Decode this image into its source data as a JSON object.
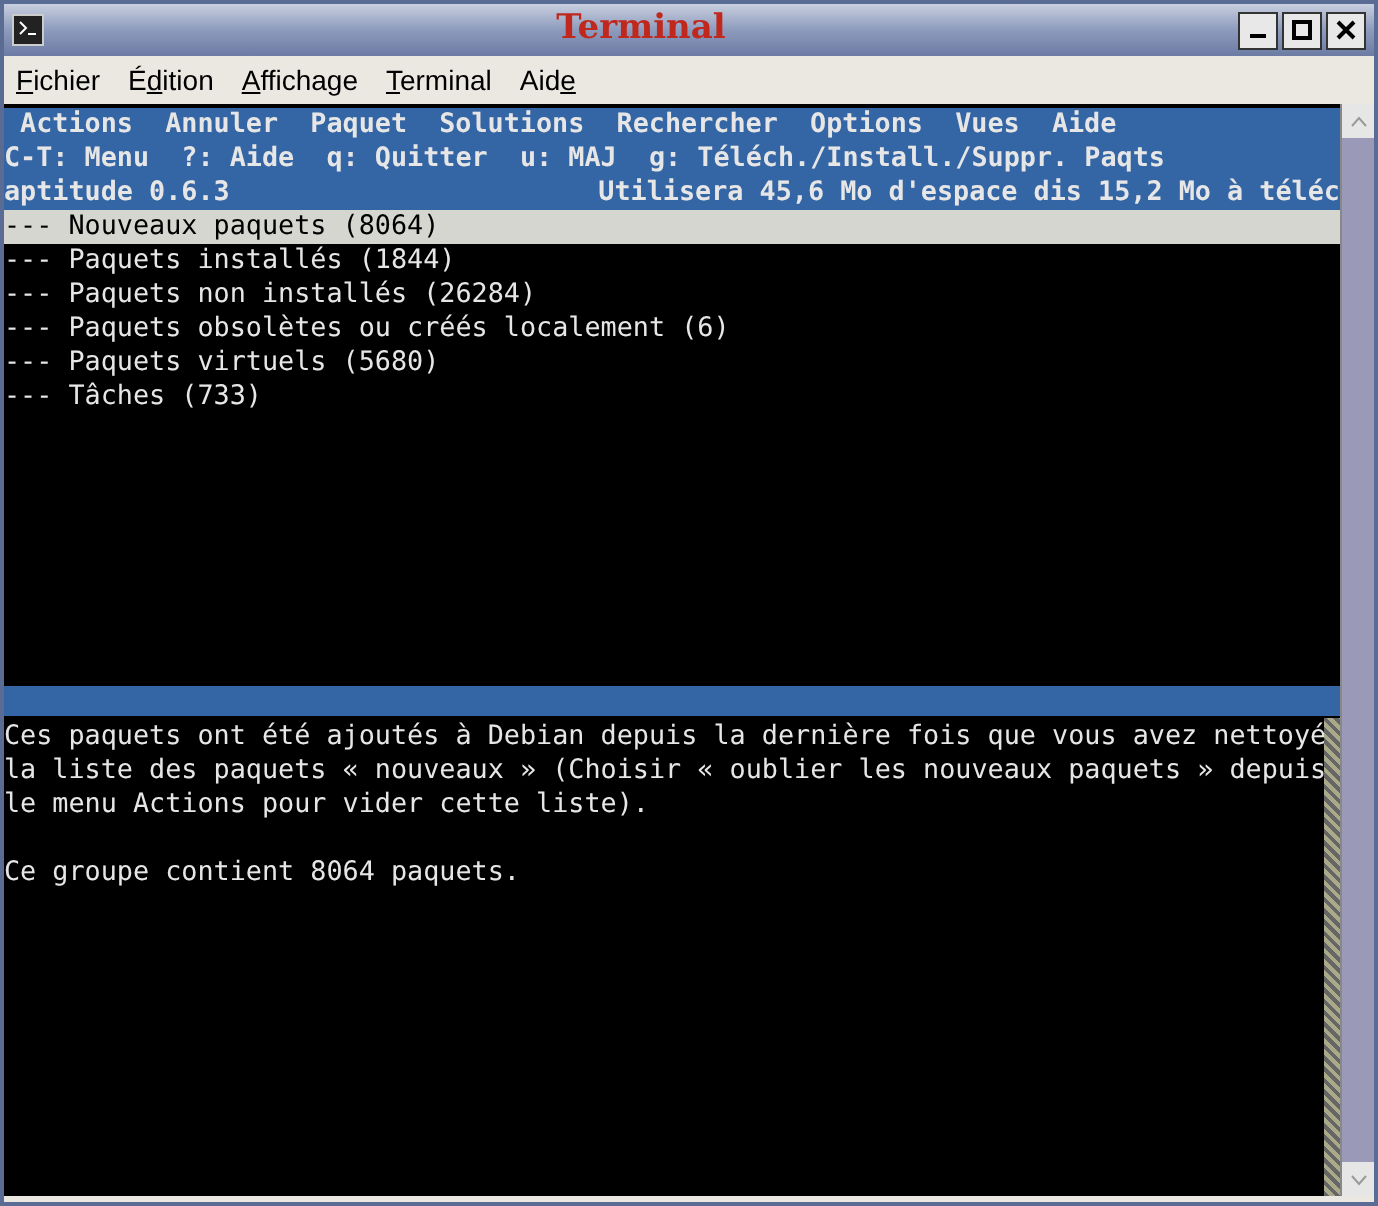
{
  "window": {
    "title": "Terminal"
  },
  "menubar": [
    {
      "key": "F",
      "rest": "ichier"
    },
    {
      "before": "É",
      "key": "d",
      "rest": "ition"
    },
    {
      "key": "A",
      "rest": "ffichage"
    },
    {
      "key": "T",
      "rest": "erminal"
    },
    {
      "before": "Aid",
      "key": "e"
    }
  ],
  "aptitude": {
    "menu": [
      "Actions",
      "Annuler",
      "Paquet",
      "Solutions",
      "Rechercher",
      "Options",
      "Vues",
      "Aide"
    ],
    "keys": "C-T: Menu  ?: Aide  q: Quitter  u: MAJ  g: Téléch./Install./Suppr. Paqts",
    "status_left": "aptitude 0.6.3",
    "status_right": "Utilisera 45,6 Mo d'espace dis 15,2 Mo à téléc",
    "tree": [
      {
        "label": "--- Nouveaux paquets (8064)",
        "selected": true
      },
      {
        "label": "--- Paquets installés (1844)",
        "selected": false
      },
      {
        "label": "--- Paquets non installés (26284)",
        "selected": false
      },
      {
        "label": "--- Paquets obsolètes ou créés localement (6)",
        "selected": false
      },
      {
        "label": "--- Paquets virtuels (5680)",
        "selected": false
      },
      {
        "label": "--- Tâches (733)",
        "selected": false
      }
    ],
    "description": [
      [
        "Ces paquets ont été ajoutés à Debian depuis la dernière fois que vous avez nettoyé",
        "la liste des paquets « nouveaux » (Choisir « oublier les nouveaux paquets » depuis",
        "le menu Actions pour vider cette liste)."
      ],
      [
        "Ce groupe contient 8064 paquets."
      ]
    ]
  }
}
